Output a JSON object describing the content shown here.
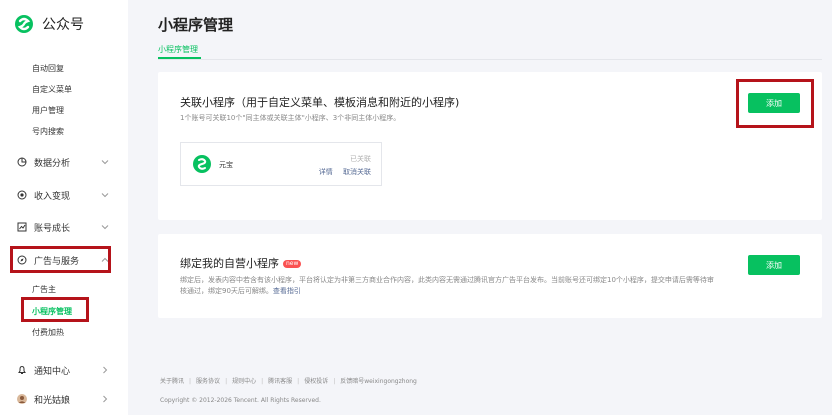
{
  "brand": {
    "name": "公众号",
    "logo_icon": "wechat-official-account-logo",
    "accent": "#07c160"
  },
  "sidebar": {
    "top_sub_items": [
      {
        "label": "自动回复"
      },
      {
        "label": "自定义菜单"
      },
      {
        "label": "用户管理"
      },
      {
        "label": "号内搜索"
      }
    ],
    "sections": [
      {
        "label": "数据分析",
        "icon": "pie-chart-icon"
      },
      {
        "label": "收入变现",
        "icon": "coin-icon"
      },
      {
        "label": "账号成长",
        "icon": "growth-chart-icon"
      },
      {
        "label": "广告与服务",
        "icon": "compass-icon"
      }
    ],
    "ad_sub_items": [
      {
        "label": "广告主"
      },
      {
        "label": "小程序管理",
        "active": true
      },
      {
        "label": "付费加热"
      }
    ],
    "notification": {
      "label": "通知中心",
      "icon": "bell-icon"
    },
    "account": {
      "label": "和光姑娘",
      "icon": "avatar-icon"
    },
    "highlight_color": "#b5131a"
  },
  "main": {
    "title": "小程序管理",
    "tab": "小程序管理",
    "card1": {
      "title": "关联小程序（用于自定义菜单、模板消息和附近的小程序)",
      "desc": "1个账号可关联10个\"同主体或关联主体\"小程序、3个非同主体小程序。",
      "add_button": "添加",
      "linked_program": {
        "name": "元宝",
        "status": "已关联",
        "detail_link": "详情",
        "unlink_link": "取消关联"
      }
    },
    "card2": {
      "title": "绑定我的自营小程序",
      "badge": "new",
      "desc": "绑定后，发表内容中若含有该小程序，平台将认定为非第三方商业合作内容，此类内容无需通过腾讯官方广告平台发布。当前账号还可绑定10个小程序，提交申请后需等待审核通过，绑定90天后可解绑。",
      "guide_link": "查看指引",
      "add_button": "添加"
    }
  },
  "footer": {
    "links": [
      "关于腾讯",
      "服务协议",
      "规则中心",
      "腾讯客服",
      "侵权投诉",
      "反馈暗号weixingongzhong"
    ],
    "copyright": "Copyright © 2012-2026 Tencent. All Rights Reserved."
  }
}
